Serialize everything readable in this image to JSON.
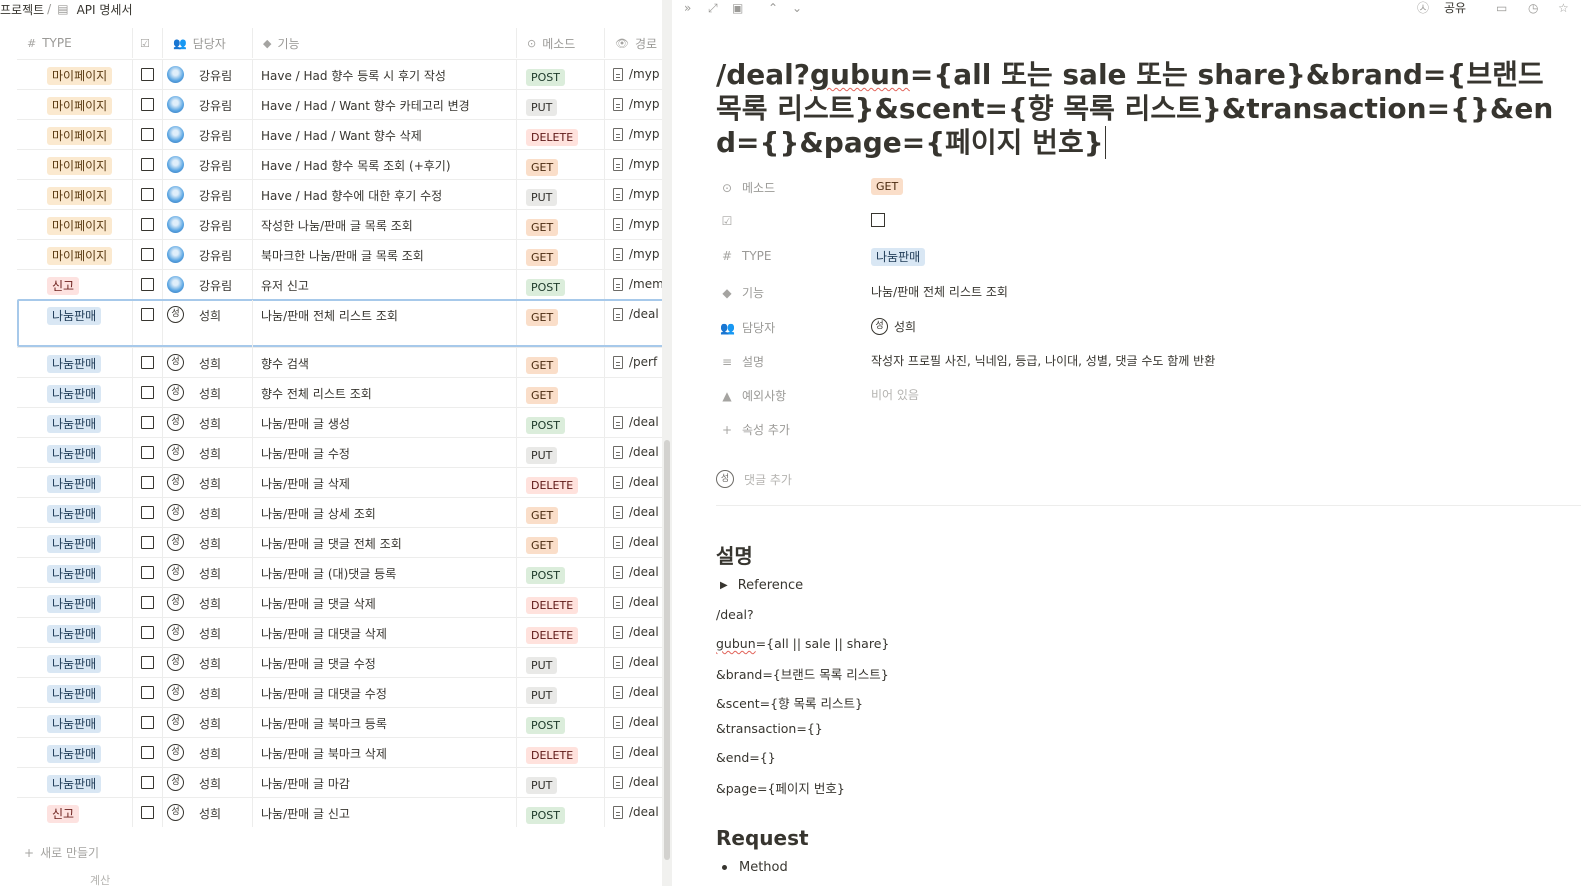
{
  "breadcrumb": {
    "project": "프로젝트",
    "separator": "/",
    "page": "API 명세서"
  },
  "table": {
    "columns": [
      {
        "label": "TYPE",
        "icon": "#"
      },
      {
        "label": "",
        "icon": "☑"
      },
      {
        "label": "담당자",
        "icon": "people"
      },
      {
        "label": "기능",
        "icon": "tag"
      },
      {
        "label": "메소드",
        "icon": "select"
      },
      {
        "label": "경로",
        "icon": "eye"
      }
    ],
    "rows": [
      {
        "type": "마이페이지",
        "assignee": "강유림",
        "avatar": "photo",
        "feature": "Have / Had 향수 등록 시 후기 작성",
        "method": "POST",
        "path": "/myp"
      },
      {
        "type": "마이페이지",
        "assignee": "강유림",
        "avatar": "photo",
        "feature": "Have / Had / Want 향수 카테고리 변경",
        "method": "PUT",
        "path": "/myp"
      },
      {
        "type": "마이페이지",
        "assignee": "강유림",
        "avatar": "photo",
        "feature": "Have / Had / Want 향수 삭제",
        "method": "DELETE",
        "path": "/myp"
      },
      {
        "type": "마이페이지",
        "assignee": "강유림",
        "avatar": "photo",
        "feature": "Have / Had 향수 목록 조회 (+후기)",
        "method": "GET",
        "path": "/myp"
      },
      {
        "type": "마이페이지",
        "assignee": "강유림",
        "avatar": "photo",
        "feature": "Have / Had 향수에 대한 후기 수정",
        "method": "PUT",
        "path": "/myp"
      },
      {
        "type": "마이페이지",
        "assignee": "강유림",
        "avatar": "photo",
        "feature": "작성한 나눔/판매 글 목록 조회",
        "method": "GET",
        "path": "/myp"
      },
      {
        "type": "마이페이지",
        "assignee": "강유림",
        "avatar": "photo",
        "feature": "북마크한 나눔/판매 글 목록 조회",
        "method": "GET",
        "path": "/myp"
      },
      {
        "type": "신고",
        "assignee": "강유림",
        "avatar": "photo",
        "feature": "유저 신고",
        "method": "POST",
        "path": "/mem"
      },
      {
        "type": "나눔판매",
        "assignee": "성희",
        "avatar": "성",
        "feature": "나눔/판매 전체 리스트 조회",
        "method": "GET",
        "path": "/deal",
        "selected": true
      },
      {
        "type": "나눔판매",
        "assignee": "성희",
        "avatar": "성",
        "feature": "향수 검색",
        "method": "GET",
        "path": "/perf"
      },
      {
        "type": "나눔판매",
        "assignee": "성희",
        "avatar": "성",
        "feature": "향수 전체 리스트 조회",
        "method": "GET",
        "path": ""
      },
      {
        "type": "나눔판매",
        "assignee": "성희",
        "avatar": "성",
        "feature": "나눔/판매 글 생성",
        "method": "POST",
        "path": "/deal"
      },
      {
        "type": "나눔판매",
        "assignee": "성희",
        "avatar": "성",
        "feature": "나눔/판매 글 수정",
        "method": "PUT",
        "path": "/deal"
      },
      {
        "type": "나눔판매",
        "assignee": "성희",
        "avatar": "성",
        "feature": "나눔/판매 글 삭제",
        "method": "DELETE",
        "path": "/deal"
      },
      {
        "type": "나눔판매",
        "assignee": "성희",
        "avatar": "성",
        "feature": "나눔/판매 글 상세 조회",
        "method": "GET",
        "path": "/deal"
      },
      {
        "type": "나눔판매",
        "assignee": "성희",
        "avatar": "성",
        "feature": "나눔/판매 글 댓글 전체 조회",
        "method": "GET",
        "path": "/deal"
      },
      {
        "type": "나눔판매",
        "assignee": "성희",
        "avatar": "성",
        "feature": "나눔/판매 글 (대)댓글 등록",
        "method": "POST",
        "path": "/deal"
      },
      {
        "type": "나눔판매",
        "assignee": "성희",
        "avatar": "성",
        "feature": "나눔/판매 글 댓글 삭제",
        "method": "DELETE",
        "path": "/deal"
      },
      {
        "type": "나눔판매",
        "assignee": "성희",
        "avatar": "성",
        "feature": "나눔/판매 글 대댓글 삭제",
        "method": "DELETE",
        "path": "/deal"
      },
      {
        "type": "나눔판매",
        "assignee": "성희",
        "avatar": "성",
        "feature": "나눔/판매 글 댓글 수정",
        "method": "PUT",
        "path": "/deal"
      },
      {
        "type": "나눔판매",
        "assignee": "성희",
        "avatar": "성",
        "feature": "나눔/판매 글 대댓글 수정",
        "method": "PUT",
        "path": "/deal"
      },
      {
        "type": "나눔판매",
        "assignee": "성희",
        "avatar": "성",
        "feature": "나눔/판매 글 북마크 등록",
        "method": "POST",
        "path": "/deal"
      },
      {
        "type": "나눔판매",
        "assignee": "성희",
        "avatar": "성",
        "feature": "나눔/판매 글 북마크 삭제",
        "method": "DELETE",
        "path": "/deal"
      },
      {
        "type": "나눔판매",
        "assignee": "성희",
        "avatar": "성",
        "feature": "나눔/판매 글 마감",
        "method": "PUT",
        "path": "/deal"
      },
      {
        "type": "신고",
        "assignee": "성희",
        "avatar": "성",
        "feature": "나눔/판매 글 신고",
        "method": "POST",
        "path": "/deal"
      }
    ],
    "new_row_label": "새로 만들기",
    "calc_label": "계산"
  },
  "topbar": {
    "share_label": "공유"
  },
  "page": {
    "title_prefix": "/deal?",
    "title_squiggle": "gubun",
    "title_rest": "={all 또는 sale 또는 share}&brand={브랜드 목록 리스트}&scent={향 목록 리스트}&transaction={}&end={}&page={페이지 번호}",
    "properties": {
      "method": {
        "label": "메소드",
        "value": "GET"
      },
      "check": {
        "label": ""
      },
      "type": {
        "label": "TYPE",
        "value": "나눔판매"
      },
      "feature": {
        "label": "기능",
        "value": "나눔/판매 전체 리스트 조회"
      },
      "assignee": {
        "label": "담당자",
        "value": "성희",
        "avatar": "성"
      },
      "description": {
        "label": "설명",
        "value": "작성자 프로필 사진, 닉네임, 등급, 나이대, 성별, 댓글 수도 함께 반환"
      },
      "exceptions": {
        "label": "예외사항",
        "value": "비어 있음"
      },
      "add_property": {
        "label": "속성 추가"
      }
    },
    "comment_placeholder": "댓글 추가",
    "comment_avatar": "성",
    "section_description": "설명",
    "toggle_label": "Reference",
    "body_lines": {
      "l1": "/deal?",
      "l2_squiggle": "gubun",
      "l2_rest": "={all || sale || share}",
      "l3": "&brand={브랜드 목록 리스트}",
      "l4": "&scent={향 목록 리스트}",
      "l5": "&transaction={}",
      "l6": "&end={}",
      "l7": "&page={페이지 번호}"
    },
    "section_request": "Request",
    "bullet_method": "Method"
  }
}
